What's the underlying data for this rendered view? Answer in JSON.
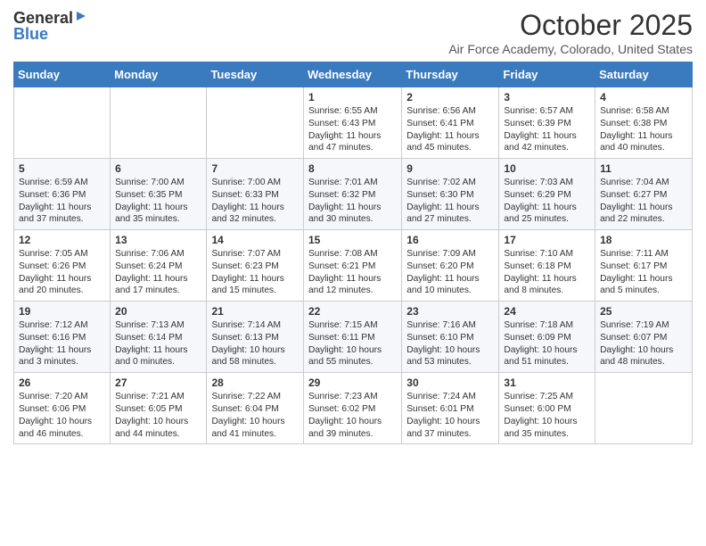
{
  "header": {
    "logo_general": "General",
    "logo_blue": "Blue",
    "title": "October 2025",
    "subtitle": "Air Force Academy, Colorado, United States"
  },
  "days_of_week": [
    "Sunday",
    "Monday",
    "Tuesday",
    "Wednesday",
    "Thursday",
    "Friday",
    "Saturday"
  ],
  "weeks": [
    [
      {
        "day": "",
        "info": ""
      },
      {
        "day": "",
        "info": ""
      },
      {
        "day": "",
        "info": ""
      },
      {
        "day": "1",
        "info": "Sunrise: 6:55 AM\nSunset: 6:43 PM\nDaylight: 11 hours\nand 47 minutes."
      },
      {
        "day": "2",
        "info": "Sunrise: 6:56 AM\nSunset: 6:41 PM\nDaylight: 11 hours\nand 45 minutes."
      },
      {
        "day": "3",
        "info": "Sunrise: 6:57 AM\nSunset: 6:39 PM\nDaylight: 11 hours\nand 42 minutes."
      },
      {
        "day": "4",
        "info": "Sunrise: 6:58 AM\nSunset: 6:38 PM\nDaylight: 11 hours\nand 40 minutes."
      }
    ],
    [
      {
        "day": "5",
        "info": "Sunrise: 6:59 AM\nSunset: 6:36 PM\nDaylight: 11 hours\nand 37 minutes."
      },
      {
        "day": "6",
        "info": "Sunrise: 7:00 AM\nSunset: 6:35 PM\nDaylight: 11 hours\nand 35 minutes."
      },
      {
        "day": "7",
        "info": "Sunrise: 7:00 AM\nSunset: 6:33 PM\nDaylight: 11 hours\nand 32 minutes."
      },
      {
        "day": "8",
        "info": "Sunrise: 7:01 AM\nSunset: 6:32 PM\nDaylight: 11 hours\nand 30 minutes."
      },
      {
        "day": "9",
        "info": "Sunrise: 7:02 AM\nSunset: 6:30 PM\nDaylight: 11 hours\nand 27 minutes."
      },
      {
        "day": "10",
        "info": "Sunrise: 7:03 AM\nSunset: 6:29 PM\nDaylight: 11 hours\nand 25 minutes."
      },
      {
        "day": "11",
        "info": "Sunrise: 7:04 AM\nSunset: 6:27 PM\nDaylight: 11 hours\nand 22 minutes."
      }
    ],
    [
      {
        "day": "12",
        "info": "Sunrise: 7:05 AM\nSunset: 6:26 PM\nDaylight: 11 hours\nand 20 minutes."
      },
      {
        "day": "13",
        "info": "Sunrise: 7:06 AM\nSunset: 6:24 PM\nDaylight: 11 hours\nand 17 minutes."
      },
      {
        "day": "14",
        "info": "Sunrise: 7:07 AM\nSunset: 6:23 PM\nDaylight: 11 hours\nand 15 minutes."
      },
      {
        "day": "15",
        "info": "Sunrise: 7:08 AM\nSunset: 6:21 PM\nDaylight: 11 hours\nand 12 minutes."
      },
      {
        "day": "16",
        "info": "Sunrise: 7:09 AM\nSunset: 6:20 PM\nDaylight: 11 hours\nand 10 minutes."
      },
      {
        "day": "17",
        "info": "Sunrise: 7:10 AM\nSunset: 6:18 PM\nDaylight: 11 hours\nand 8 minutes."
      },
      {
        "day": "18",
        "info": "Sunrise: 7:11 AM\nSunset: 6:17 PM\nDaylight: 11 hours\nand 5 minutes."
      }
    ],
    [
      {
        "day": "19",
        "info": "Sunrise: 7:12 AM\nSunset: 6:16 PM\nDaylight: 11 hours\nand 3 minutes."
      },
      {
        "day": "20",
        "info": "Sunrise: 7:13 AM\nSunset: 6:14 PM\nDaylight: 11 hours\nand 0 minutes."
      },
      {
        "day": "21",
        "info": "Sunrise: 7:14 AM\nSunset: 6:13 PM\nDaylight: 10 hours\nand 58 minutes."
      },
      {
        "day": "22",
        "info": "Sunrise: 7:15 AM\nSunset: 6:11 PM\nDaylight: 10 hours\nand 55 minutes."
      },
      {
        "day": "23",
        "info": "Sunrise: 7:16 AM\nSunset: 6:10 PM\nDaylight: 10 hours\nand 53 minutes."
      },
      {
        "day": "24",
        "info": "Sunrise: 7:18 AM\nSunset: 6:09 PM\nDaylight: 10 hours\nand 51 minutes."
      },
      {
        "day": "25",
        "info": "Sunrise: 7:19 AM\nSunset: 6:07 PM\nDaylight: 10 hours\nand 48 minutes."
      }
    ],
    [
      {
        "day": "26",
        "info": "Sunrise: 7:20 AM\nSunset: 6:06 PM\nDaylight: 10 hours\nand 46 minutes."
      },
      {
        "day": "27",
        "info": "Sunrise: 7:21 AM\nSunset: 6:05 PM\nDaylight: 10 hours\nand 44 minutes."
      },
      {
        "day": "28",
        "info": "Sunrise: 7:22 AM\nSunset: 6:04 PM\nDaylight: 10 hours\nand 41 minutes."
      },
      {
        "day": "29",
        "info": "Sunrise: 7:23 AM\nSunset: 6:02 PM\nDaylight: 10 hours\nand 39 minutes."
      },
      {
        "day": "30",
        "info": "Sunrise: 7:24 AM\nSunset: 6:01 PM\nDaylight: 10 hours\nand 37 minutes."
      },
      {
        "day": "31",
        "info": "Sunrise: 7:25 AM\nSunset: 6:00 PM\nDaylight: 10 hours\nand 35 minutes."
      },
      {
        "day": "",
        "info": ""
      }
    ]
  ]
}
